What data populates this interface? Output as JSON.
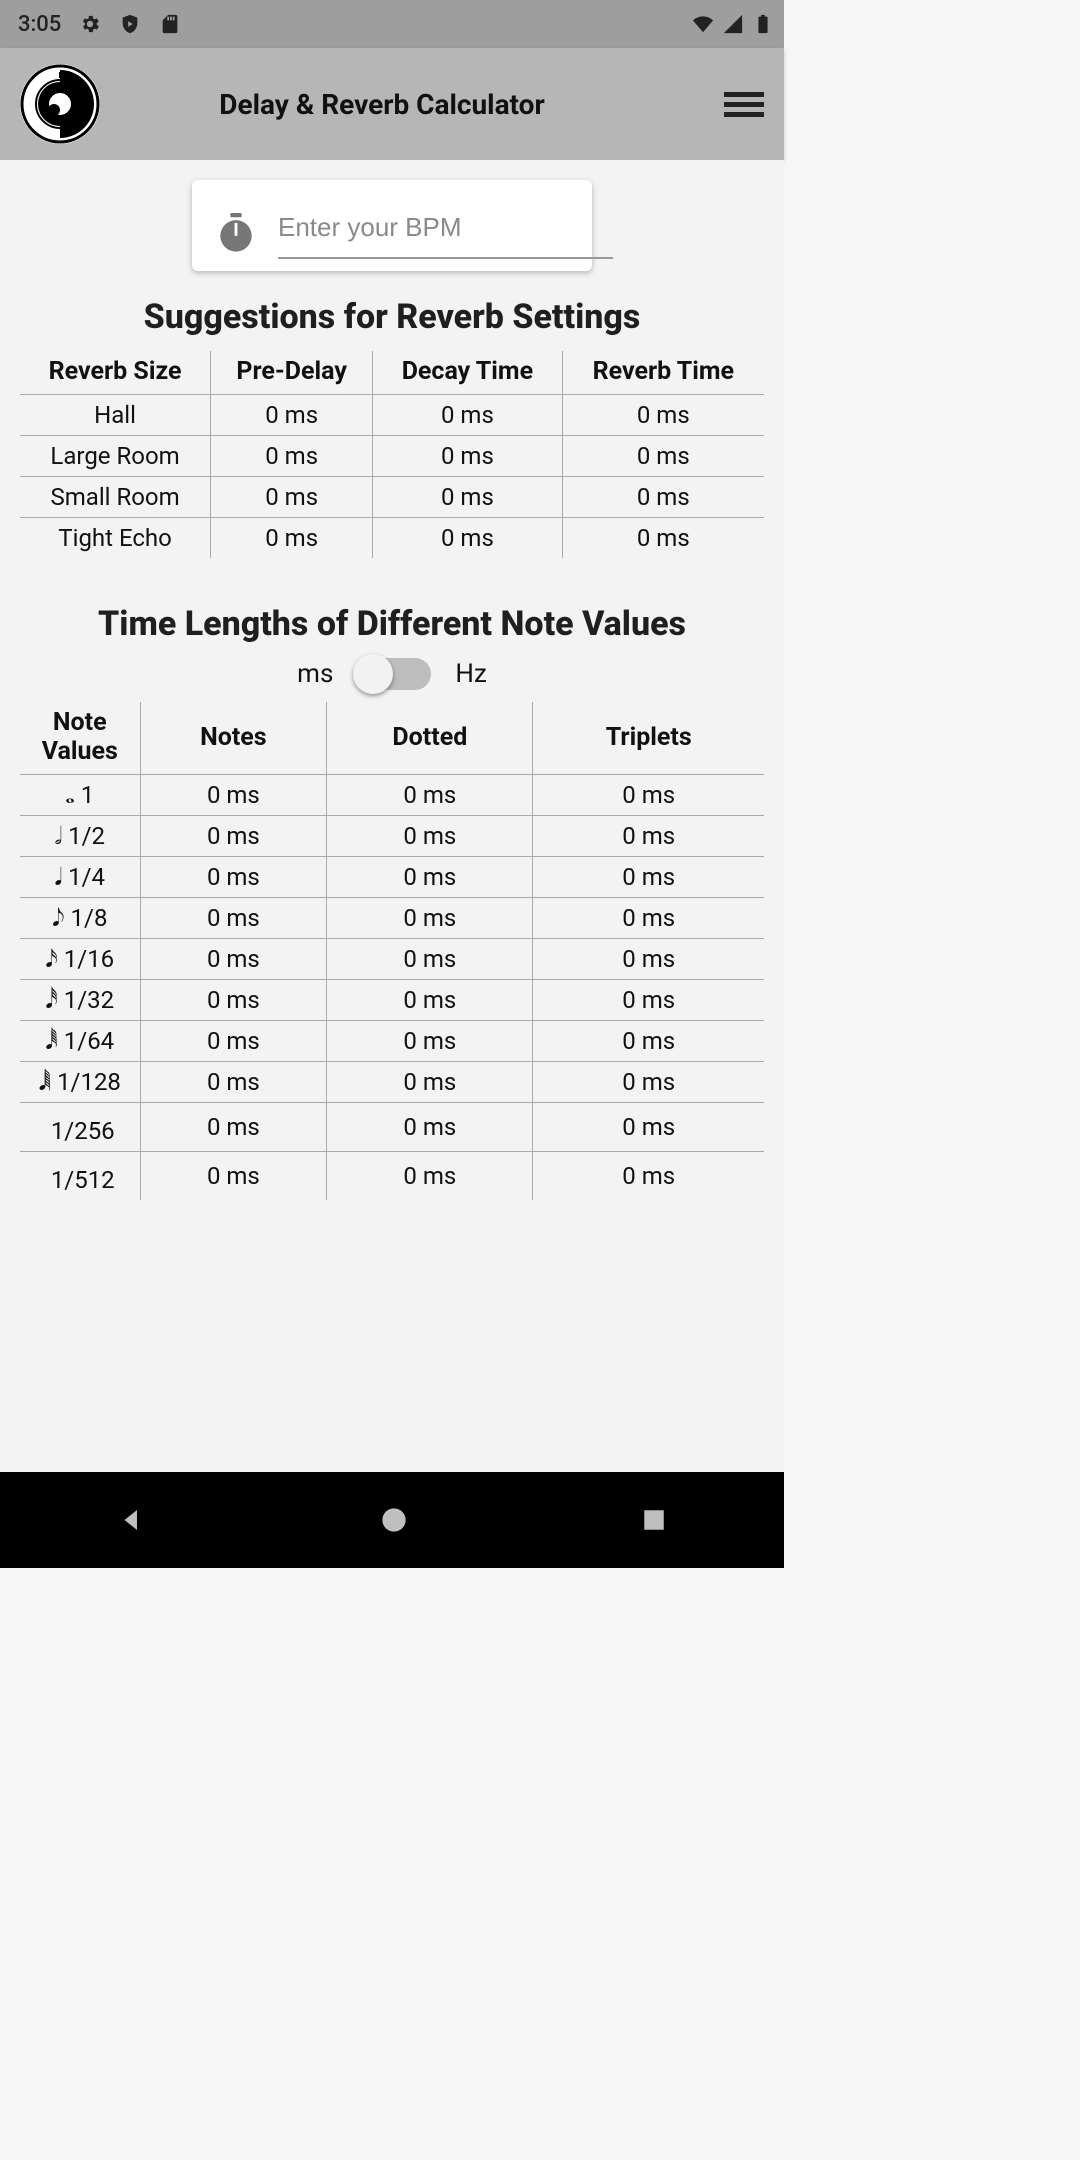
{
  "status": {
    "time": "3:05"
  },
  "appbar": {
    "title": "Delay & Reverb Calculator"
  },
  "input": {
    "placeholder": "Enter your BPM"
  },
  "sections": {
    "reverb_title": "Suggestions for Reverb Settings",
    "notes_title": "Time Lengths of Different Note Values"
  },
  "unit": {
    "ms": "ms",
    "hz": "Hz",
    "state": "ms"
  },
  "reverb": {
    "headers": [
      "Reverb Size",
      "Pre-Delay",
      "Decay Time",
      "Reverb Time"
    ],
    "rows": [
      {
        "size": "Hall",
        "pre": "0 ms",
        "decay": "0 ms",
        "time": "0 ms"
      },
      {
        "size": "Large Room",
        "pre": "0 ms",
        "decay": "0 ms",
        "time": "0 ms"
      },
      {
        "size": "Small Room",
        "pre": "0 ms",
        "decay": "0 ms",
        "time": "0 ms"
      },
      {
        "size": "Tight Echo",
        "pre": "0 ms",
        "decay": "0 ms",
        "time": "0 ms"
      }
    ]
  },
  "notes": {
    "headers": [
      "Note Values",
      "Notes",
      "Dotted",
      "Triplets"
    ],
    "rows": [
      {
        "sym": "𝅝",
        "label": "1",
        "n": "0 ms",
        "d": "0 ms",
        "t": "0 ms"
      },
      {
        "sym": "𝅗𝅥",
        "label": "1/2",
        "n": "0 ms",
        "d": "0 ms",
        "t": "0 ms"
      },
      {
        "sym": "𝅘𝅥",
        "label": "1/4",
        "n": "0 ms",
        "d": "0 ms",
        "t": "0 ms"
      },
      {
        "sym": "𝅘𝅥𝅮",
        "label": "1/8",
        "n": "0 ms",
        "d": "0 ms",
        "t": "0 ms"
      },
      {
        "sym": "𝅘𝅥𝅯",
        "label": "1/16",
        "n": "0 ms",
        "d": "0 ms",
        "t": "0 ms"
      },
      {
        "sym": "𝅘𝅥𝅰",
        "label": "1/32",
        "n": "0 ms",
        "d": "0 ms",
        "t": "0 ms"
      },
      {
        "sym": "𝅘𝅥𝅱",
        "label": "1/64",
        "n": "0 ms",
        "d": "0 ms",
        "t": "0 ms"
      },
      {
        "sym": "𝅘𝅥𝅲",
        "label": "1/128",
        "n": "0 ms",
        "d": "0 ms",
        "t": "0 ms"
      },
      {
        "sym": "",
        "label": "1/256",
        "n": "0 ms",
        "d": "0 ms",
        "t": "0 ms"
      },
      {
        "sym": "",
        "label": "1/512",
        "n": "0 ms",
        "d": "0 ms",
        "t": "0 ms"
      }
    ]
  }
}
